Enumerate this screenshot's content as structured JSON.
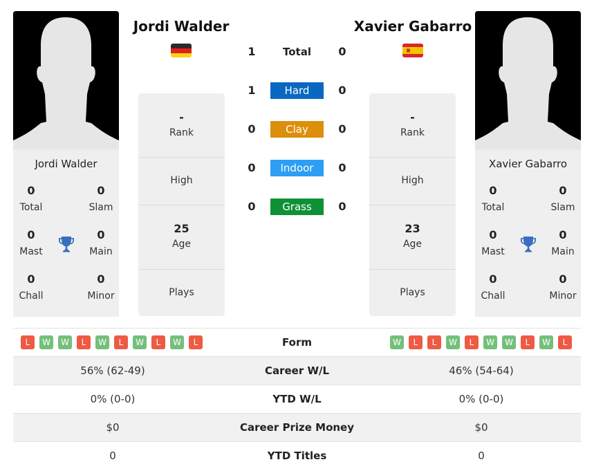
{
  "players": [
    {
      "name": "Jordi Walder",
      "flag": "germany-flag",
      "card": {
        "name": "Jordi Walder",
        "stats": [
          {
            "value": "0",
            "label": "Total"
          },
          {
            "value": "0",
            "label": "Slam"
          },
          {
            "value": "0",
            "label": "Mast"
          },
          {
            "value": "0",
            "label": "Main"
          },
          {
            "value": "0",
            "label": "Chall"
          },
          {
            "value": "0",
            "label": "Minor"
          }
        ]
      },
      "info": {
        "rank_value": "-",
        "rank_label": "Rank",
        "high_label": "High",
        "age_value": "25",
        "age_label": "Age",
        "plays_label": "Plays"
      },
      "form": [
        "L",
        "W",
        "W",
        "L",
        "W",
        "L",
        "W",
        "L",
        "W",
        "L"
      ],
      "career_wl": "56% (62-49)",
      "ytd_wl": "0% (0-0)",
      "prize_money": "$0",
      "ytd_titles": "0"
    },
    {
      "name": "Xavier Gabarro",
      "flag": "spain-flag",
      "card": {
        "name": "Xavier Gabarro",
        "stats": [
          {
            "value": "0",
            "label": "Total"
          },
          {
            "value": "0",
            "label": "Slam"
          },
          {
            "value": "0",
            "label": "Mast"
          },
          {
            "value": "0",
            "label": "Main"
          },
          {
            "value": "0",
            "label": "Chall"
          },
          {
            "value": "0",
            "label": "Minor"
          }
        ]
      },
      "info": {
        "rank_value": "-",
        "rank_label": "Rank",
        "high_label": "High",
        "age_value": "23",
        "age_label": "Age",
        "plays_label": "Plays"
      },
      "form": [
        "W",
        "L",
        "L",
        "W",
        "L",
        "W",
        "W",
        "L",
        "W",
        "L"
      ],
      "career_wl": "46% (54-64)",
      "ytd_wl": "0% (0-0)",
      "prize_money": "$0",
      "ytd_titles": "0"
    }
  ],
  "h2h": [
    {
      "label": "Total",
      "left": "1",
      "right": "0",
      "color": ""
    },
    {
      "label": "Hard",
      "left": "1",
      "right": "0",
      "color": "#0a68c2"
    },
    {
      "label": "Clay",
      "left": "0",
      "right": "0",
      "color": "#dc8f0b"
    },
    {
      "label": "Indoor",
      "left": "0",
      "right": "0",
      "color": "#2c9ef4"
    },
    {
      "label": "Grass",
      "left": "0",
      "right": "0",
      "color": "#0e9136"
    }
  ],
  "table_labels": {
    "form": "Form",
    "career_wl": "Career W/L",
    "ytd_wl": "YTD W/L",
    "prize_money": "Career Prize Money",
    "ytd_titles": "YTD Titles"
  },
  "colors": {
    "win": "#74c07b",
    "loss": "#ee5a43",
    "trophy": "#3a6fc0"
  }
}
